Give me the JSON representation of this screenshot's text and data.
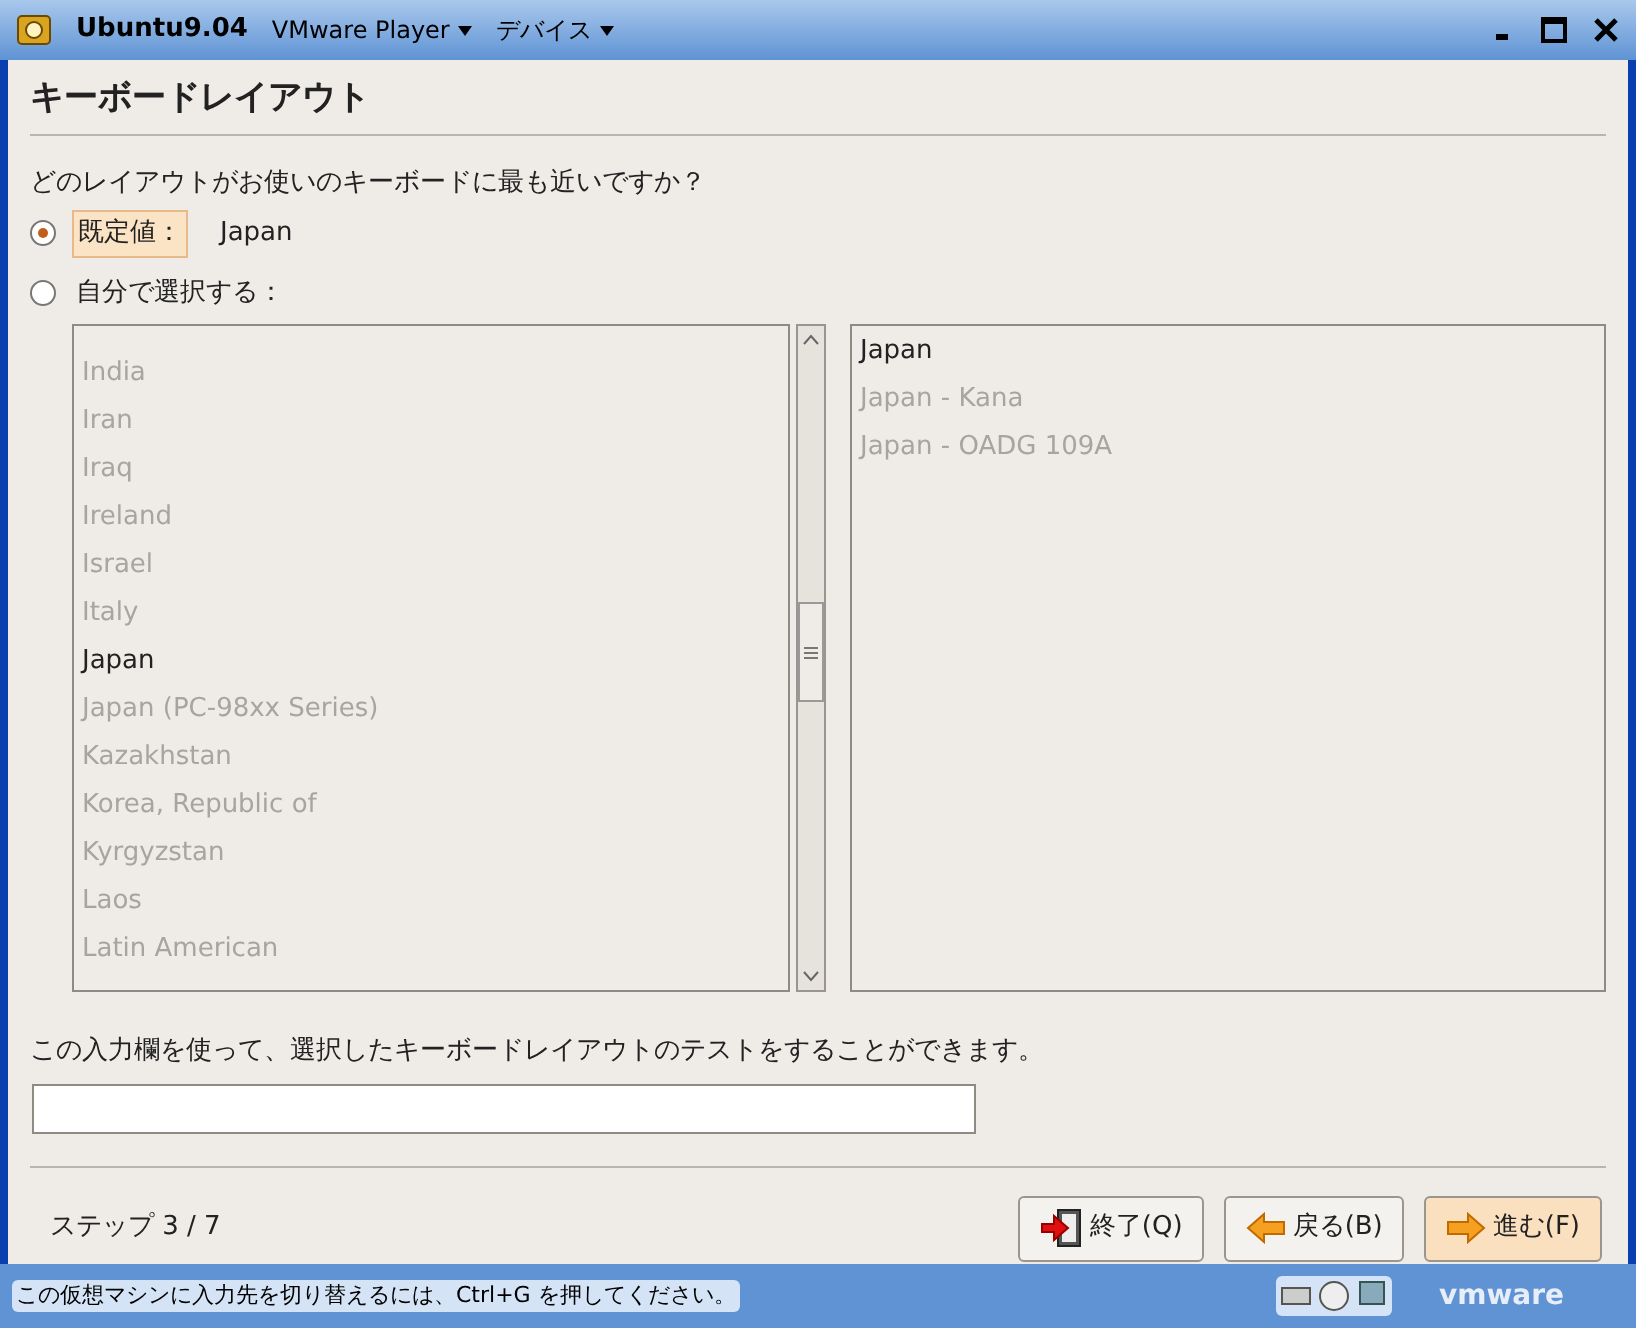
{
  "window": {
    "title": "Ubuntu9.04",
    "menus": [
      {
        "label": "VMware Player"
      },
      {
        "label": "デバイス"
      }
    ]
  },
  "heading": "キーボードレイアウト",
  "question": "どのレイアウトがお使いのキーボードに最も近いですか？",
  "options": [
    {
      "label": "既定値：",
      "value": "Japan",
      "selected": true
    },
    {
      "label": "自分で選択する：",
      "selected": false
    }
  ],
  "countries": [
    {
      "label": "India",
      "selected": false
    },
    {
      "label": "Iran",
      "selected": false
    },
    {
      "label": "Iraq",
      "selected": false
    },
    {
      "label": "Ireland",
      "selected": false
    },
    {
      "label": "Israel",
      "selected": false
    },
    {
      "label": "Italy",
      "selected": false
    },
    {
      "label": "Japan",
      "selected": true
    },
    {
      "label": "Japan (PC-98xx Series)",
      "selected": false
    },
    {
      "label": "Kazakhstan",
      "selected": false
    },
    {
      "label": "Korea, Republic of",
      "selected": false
    },
    {
      "label": "Kyrgyzstan",
      "selected": false
    },
    {
      "label": "Laos",
      "selected": false
    },
    {
      "label": "Latin American",
      "selected": false
    }
  ],
  "variants": [
    {
      "label": "Japan",
      "selected": true
    },
    {
      "label": "Japan - Kana",
      "selected": false
    },
    {
      "label": "Japan - OADG 109A",
      "selected": false
    }
  ],
  "test_hint": "この入力欄を使って、選択したキーボードレイアウトのテストをすることができます。",
  "step": "ステップ 3 / 7",
  "buttons": [
    {
      "kind": "quit",
      "label": "終了(Q)"
    },
    {
      "kind": "back",
      "label": "戻る(B)"
    },
    {
      "kind": "forward",
      "label": "進む(F)"
    }
  ],
  "status_bar": {
    "message": "この仮想マシンに入力先を切り替えるには、Ctrl+G を押してください。",
    "logo": "vmware"
  }
}
